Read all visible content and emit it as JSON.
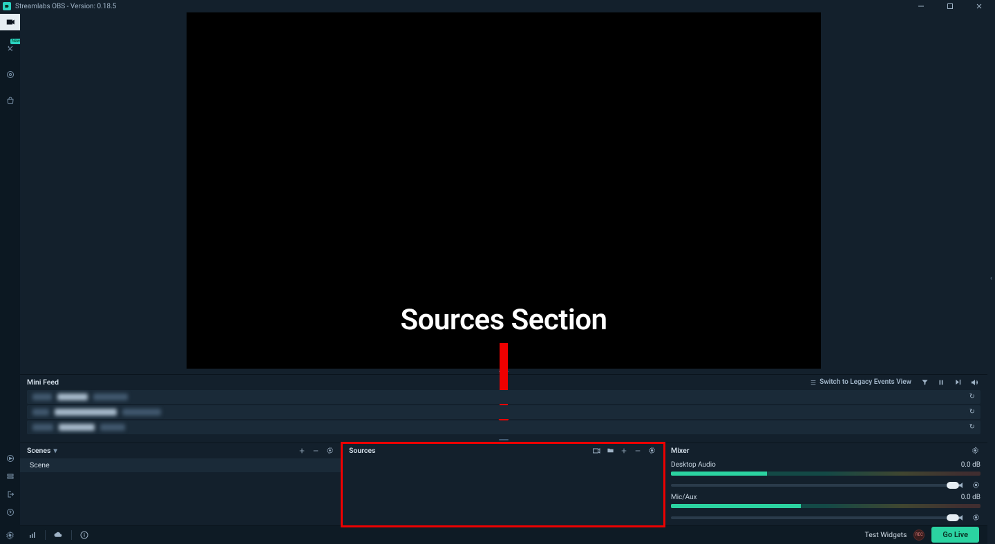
{
  "titlebar": {
    "title": "Streamlabs OBS - Version: 0.18.5"
  },
  "sidebar": {
    "badge_new": "New",
    "items": [
      {
        "name": "editor"
      },
      {
        "name": "themes"
      },
      {
        "name": "dashboard"
      },
      {
        "name": "store"
      }
    ]
  },
  "overlay": {
    "label": "Sources Section"
  },
  "miniFeed": {
    "title": "Mini Feed",
    "legacy_link": "Switch to Legacy Events View"
  },
  "panels": {
    "scenes": {
      "title": "Scenes",
      "items": [
        {
          "label": "Scene"
        }
      ]
    },
    "sources": {
      "title": "Sources"
    },
    "mixer": {
      "title": "Mixer",
      "tracks": [
        {
          "label": "Desktop Audio",
          "db": "0.0 dB",
          "level_pct": 31
        },
        {
          "label": "Mic/Aux",
          "db": "0.0 dB",
          "level_pct": 42
        }
      ]
    }
  },
  "bottombar": {
    "test_widgets": "Test Widgets",
    "rec_label": "REC",
    "go_live": "Go Live"
  }
}
